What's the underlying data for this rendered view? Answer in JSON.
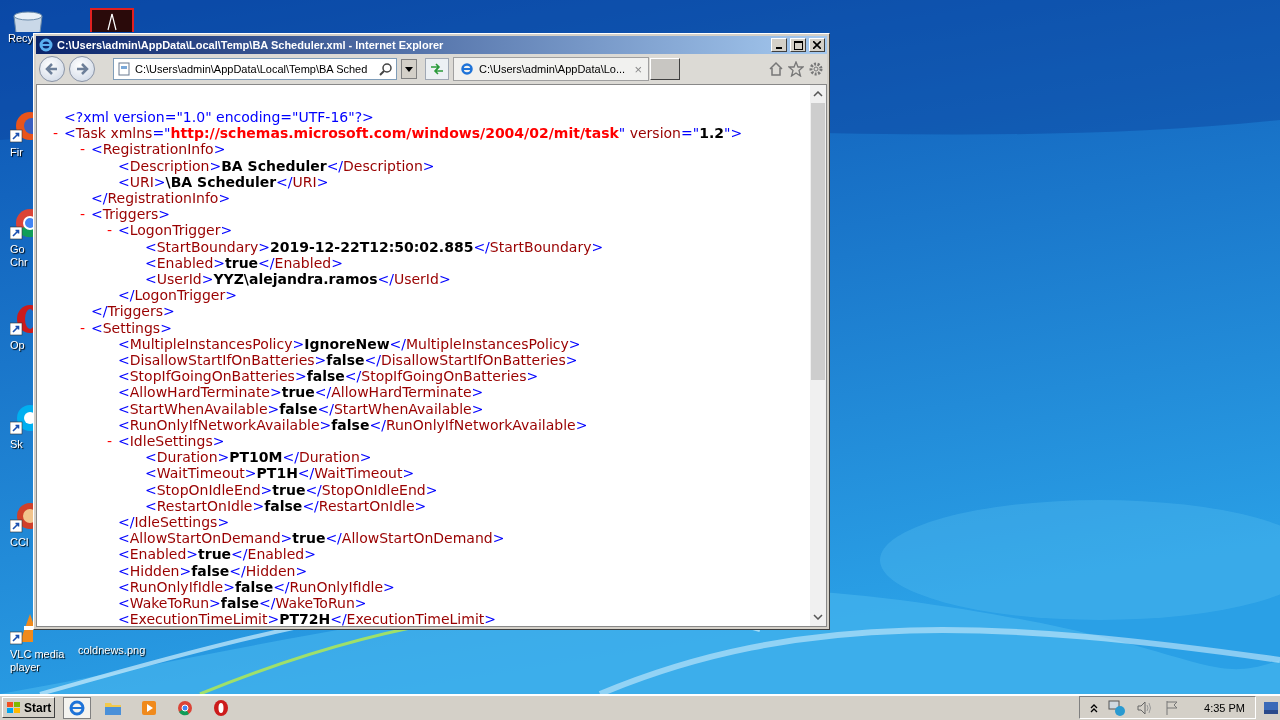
{
  "desktop_icons": [
    {
      "lines": [
        "Recy"
      ]
    },
    {
      "lines": [
        "Fir"
      ]
    },
    {
      "lines": [
        "Go",
        "Chr"
      ]
    },
    {
      "lines": [
        "Op"
      ]
    },
    {
      "lines": [
        "Sk"
      ]
    },
    {
      "lines": [
        "CCl"
      ]
    },
    {
      "lines": [
        "VLC media",
        "player"
      ]
    },
    {
      "lines": [
        "coldnews.png"
      ]
    }
  ],
  "window": {
    "title": "C:\\Users\\admin\\AppData\\Local\\Temp\\BA Scheduler.xml - Internet Explorer",
    "address": "C:\\Users\\admin\\AppData\\Local\\Temp\\BA Sched",
    "tab_title": "C:\\Users\\admin\\AppData\\Lo...",
    "tab_close": "×"
  },
  "xml": [
    {
      "kind": "decl",
      "text": "<?xml version=\"1.0\" encoding=\"UTF-16\"?>"
    },
    {
      "kind": "element",
      "toggle": "-",
      "open": "<Task",
      "attrs": [
        {
          "name": " xmlns",
          "eq": "=\"",
          "value": "http://schemas.microsoft.com/windows/2004/02/mit/task",
          "q": "\""
        },
        {
          "name": " version",
          "eq": "=\"",
          "value": "1.2",
          "q": "\""
        }
      ],
      "gt": ">",
      "children": [
        {
          "kind": "element",
          "toggle": "-",
          "open": "<RegistrationInfo>",
          "close": "</RegistrationInfo>",
          "children": [
            {
              "kind": "leaf",
              "open": "<Description>",
              "value": "BA Scheduler",
              "close": "</Description>"
            },
            {
              "kind": "leaf",
              "open": "<URI>",
              "value": "\\BA Scheduler",
              "close": "</URI>"
            }
          ]
        },
        {
          "kind": "element",
          "toggle": "-",
          "open": "<Triggers>",
          "close": "</Triggers>",
          "children": [
            {
              "kind": "element",
              "toggle": "-",
              "open": "<LogonTrigger>",
              "close": "</LogonTrigger>",
              "children": [
                {
                  "kind": "leaf",
                  "open": "<StartBoundary>",
                  "value": "2019-12-22T12:50:02.885",
                  "close": "</StartBoundary>"
                },
                {
                  "kind": "leaf",
                  "open": "<Enabled>",
                  "value": "true",
                  "close": "</Enabled>"
                },
                {
                  "kind": "leaf",
                  "open": "<UserId>",
                  "value": "YYZ\\alejandra.ramos",
                  "close": "</UserId>"
                }
              ]
            }
          ]
        },
        {
          "kind": "element",
          "toggle": "-",
          "open": "<Settings>",
          "children": [
            {
              "kind": "leaf",
              "open": "<MultipleInstancesPolicy>",
              "value": "IgnoreNew",
              "close": "</MultipleInstancesPolicy>"
            },
            {
              "kind": "leaf",
              "open": "<DisallowStartIfOnBatteries>",
              "value": "false",
              "close": "</DisallowStartIfOnBatteries>"
            },
            {
              "kind": "leaf",
              "open": "<StopIfGoingOnBatteries>",
              "value": "false",
              "close": "</StopIfGoingOnBatteries>"
            },
            {
              "kind": "leaf",
              "open": "<AllowHardTerminate>",
              "value": "true",
              "close": "</AllowHardTerminate>"
            },
            {
              "kind": "leaf",
              "open": "<StartWhenAvailable>",
              "value": "false",
              "close": "</StartWhenAvailable>"
            },
            {
              "kind": "leaf",
              "open": "<RunOnlyIfNetworkAvailable>",
              "value": "false",
              "close": "</RunOnlyIfNetworkAvailable>"
            },
            {
              "kind": "element",
              "toggle": "-",
              "open": "<IdleSettings>",
              "close": "</IdleSettings>",
              "children": [
                {
                  "kind": "leaf",
                  "open": "<Duration>",
                  "value": "PT10M",
                  "close": "</Duration>"
                },
                {
                  "kind": "leaf",
                  "open": "<WaitTimeout>",
                  "value": "PT1H",
                  "close": "</WaitTimeout>"
                },
                {
                  "kind": "leaf",
                  "open": "<StopOnIdleEnd>",
                  "value": "true",
                  "close": "</StopOnIdleEnd>"
                },
                {
                  "kind": "leaf",
                  "open": "<RestartOnIdle>",
                  "value": "false",
                  "close": "</RestartOnIdle>"
                }
              ]
            },
            {
              "kind": "leaf",
              "open": "<AllowStartOnDemand>",
              "value": "true",
              "close": "</AllowStartOnDemand>"
            },
            {
              "kind": "leaf",
              "open": "<Enabled>",
              "value": "true",
              "close": "</Enabled>"
            },
            {
              "kind": "leaf",
              "open": "<Hidden>",
              "value": "false",
              "close": "</Hidden>"
            },
            {
              "kind": "leaf",
              "open": "<RunOnlyIfIdle>",
              "value": "false",
              "close": "</RunOnlyIfIdle>"
            },
            {
              "kind": "leaf",
              "open": "<WakeToRun>",
              "value": "false",
              "close": "</WakeToRun>"
            },
            {
              "kind": "leaf",
              "open": "<ExecutionTimeLimit>",
              "value": "PT72H",
              "close": "</ExecutionTimeLimit>"
            }
          ]
        }
      ]
    }
  ],
  "taskbar": {
    "start": "Start",
    "apps": [
      {
        "selected": true
      },
      {
        "selected": false
      },
      {
        "selected": false
      },
      {
        "selected": false
      },
      {
        "selected": false
      }
    ],
    "clock": "4:35 PM"
  }
}
